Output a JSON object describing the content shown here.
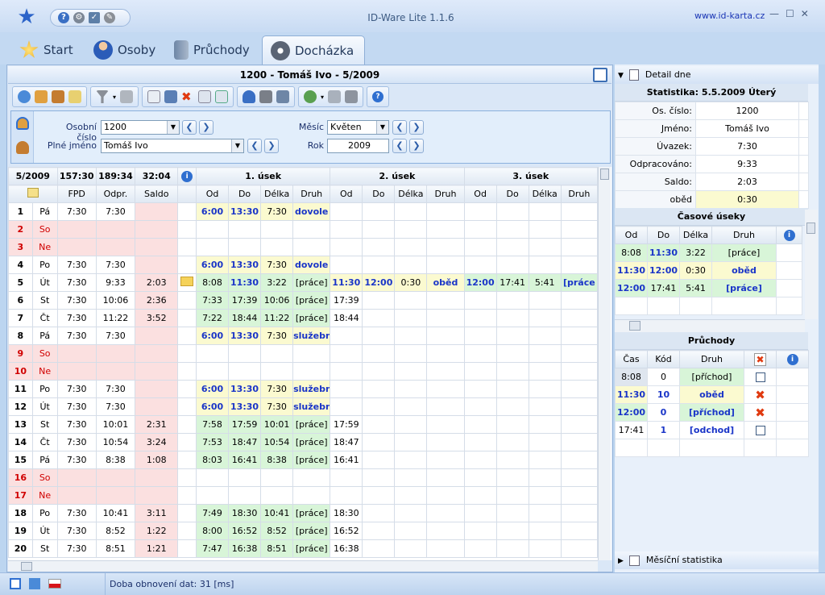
{
  "app": {
    "title": "ID-Ware Lite 1.1.6",
    "website": "www.id-karta.cz",
    "win_min": "—",
    "win_max": "☐",
    "win_close": "✕"
  },
  "tabs": [
    {
      "label": "Start"
    },
    {
      "label": "Osoby"
    },
    {
      "label": "Průchody"
    },
    {
      "label": "Docházka"
    }
  ],
  "main": {
    "title": "1200 - Tomáš Ivo - 5/2009"
  },
  "filter": {
    "personal_label": "Osobní číslo",
    "personal_value": "1200",
    "fullname_label": "Plné jméno",
    "fullname_value": "Tomáš Ivo",
    "month_label": "Měsíc",
    "month_value": "Květen",
    "year_label": "Rok",
    "year_value": "2009"
  },
  "grid": {
    "summary": [
      "5/2009",
      "157:30",
      "189:34",
      "32:04"
    ],
    "sections": [
      "1. úsek",
      "2. úsek",
      "3. úsek"
    ],
    "col_headers": [
      "FPD",
      "Odpr.",
      "Saldo"
    ],
    "seg_headers": [
      "Od",
      "Do",
      "Délka",
      "Druh"
    ],
    "rows": [
      {
        "n": "1",
        "d": "Pá",
        "fpd": "7:30",
        "odpr": "7:30",
        "saldo": "",
        "note": false,
        "s1": [
          "6:00",
          "13:30",
          "7:30",
          "dovole"
        ],
        "s1t": "y",
        "s2": [
          "",
          "",
          "",
          ""
        ],
        "s3": [
          "",
          "",
          "",
          ""
        ],
        "we": false
      },
      {
        "n": "2",
        "d": "So",
        "fpd": "",
        "odpr": "",
        "saldo": "",
        "note": false,
        "s1": [
          "",
          "",
          "",
          ""
        ],
        "s1t": "",
        "s2": [
          "",
          "",
          "",
          ""
        ],
        "s3": [
          "",
          "",
          "",
          ""
        ],
        "we": true
      },
      {
        "n": "3",
        "d": "Ne",
        "fpd": "",
        "odpr": "",
        "saldo": "",
        "note": false,
        "s1": [
          "",
          "",
          "",
          ""
        ],
        "s1t": "",
        "s2": [
          "",
          "",
          "",
          ""
        ],
        "s3": [
          "",
          "",
          "",
          ""
        ],
        "we": true
      },
      {
        "n": "4",
        "d": "Po",
        "fpd": "7:30",
        "odpr": "7:30",
        "saldo": "",
        "note": false,
        "s1": [
          "6:00",
          "13:30",
          "7:30",
          "dovole"
        ],
        "s1t": "y",
        "s2": [
          "",
          "",
          "",
          ""
        ],
        "s3": [
          "",
          "",
          "",
          ""
        ],
        "we": false
      },
      {
        "n": "5",
        "d": "Út",
        "fpd": "7:30",
        "odpr": "9:33",
        "saldo": "2:03",
        "note": true,
        "s1": [
          "8:08",
          "11:30",
          "3:22",
          "[práce]"
        ],
        "s1t": "g",
        "s2": [
          "11:30",
          "12:00",
          "0:30",
          "oběd"
        ],
        "s3": [
          "12:00",
          "17:41",
          "5:41",
          "[práce"
        ],
        "we": false
      },
      {
        "n": "6",
        "d": "St",
        "fpd": "7:30",
        "odpr": "10:06",
        "saldo": "2:36",
        "note": false,
        "s1": [
          "7:33",
          "17:39",
          "10:06",
          "[práce]"
        ],
        "s1t": "g",
        "s2": [
          "17:39",
          "",
          "",
          ""
        ],
        "s3": [
          "",
          "",
          "",
          ""
        ],
        "we": false
      },
      {
        "n": "7",
        "d": "Čt",
        "fpd": "7:30",
        "odpr": "11:22",
        "saldo": "3:52",
        "note": false,
        "s1": [
          "7:22",
          "18:44",
          "11:22",
          "[práce]"
        ],
        "s1t": "g",
        "s2": [
          "18:44",
          "",
          "",
          ""
        ],
        "s3": [
          "",
          "",
          "",
          ""
        ],
        "we": false
      },
      {
        "n": "8",
        "d": "Pá",
        "fpd": "7:30",
        "odpr": "7:30",
        "saldo": "",
        "note": false,
        "s1": [
          "6:00",
          "13:30",
          "7:30",
          "služebn"
        ],
        "s1t": "y",
        "s2": [
          "",
          "",
          "",
          ""
        ],
        "s3": [
          "",
          "",
          "",
          ""
        ],
        "we": false
      },
      {
        "n": "9",
        "d": "So",
        "fpd": "",
        "odpr": "",
        "saldo": "",
        "note": false,
        "s1": [
          "",
          "",
          "",
          ""
        ],
        "s1t": "",
        "s2": [
          "",
          "",
          "",
          ""
        ],
        "s3": [
          "",
          "",
          "",
          ""
        ],
        "we": true
      },
      {
        "n": "10",
        "d": "Ne",
        "fpd": "",
        "odpr": "",
        "saldo": "",
        "note": false,
        "s1": [
          "",
          "",
          "",
          ""
        ],
        "s1t": "",
        "s2": [
          "",
          "",
          "",
          ""
        ],
        "s3": [
          "",
          "",
          "",
          ""
        ],
        "we": true
      },
      {
        "n": "11",
        "d": "Po",
        "fpd": "7:30",
        "odpr": "7:30",
        "saldo": "",
        "note": false,
        "s1": [
          "6:00",
          "13:30",
          "7:30",
          "služebn"
        ],
        "s1t": "y",
        "s2": [
          "",
          "",
          "",
          ""
        ],
        "s3": [
          "",
          "",
          "",
          ""
        ],
        "we": false
      },
      {
        "n": "12",
        "d": "Út",
        "fpd": "7:30",
        "odpr": "7:30",
        "saldo": "",
        "note": false,
        "s1": [
          "6:00",
          "13:30",
          "7:30",
          "služebn"
        ],
        "s1t": "y",
        "s2": [
          "",
          "",
          "",
          ""
        ],
        "s3": [
          "",
          "",
          "",
          ""
        ],
        "we": false
      },
      {
        "n": "13",
        "d": "St",
        "fpd": "7:30",
        "odpr": "10:01",
        "saldo": "2:31",
        "note": false,
        "s1": [
          "7:58",
          "17:59",
          "10:01",
          "[práce]"
        ],
        "s1t": "g",
        "s2": [
          "17:59",
          "",
          "",
          ""
        ],
        "s3": [
          "",
          "",
          "",
          ""
        ],
        "we": false
      },
      {
        "n": "14",
        "d": "Čt",
        "fpd": "7:30",
        "odpr": "10:54",
        "saldo": "3:24",
        "note": false,
        "s1": [
          "7:53",
          "18:47",
          "10:54",
          "[práce]"
        ],
        "s1t": "g",
        "s2": [
          "18:47",
          "",
          "",
          ""
        ],
        "s3": [
          "",
          "",
          "",
          ""
        ],
        "we": false
      },
      {
        "n": "15",
        "d": "Pá",
        "fpd": "7:30",
        "odpr": "8:38",
        "saldo": "1:08",
        "note": false,
        "s1": [
          "8:03",
          "16:41",
          "8:38",
          "[práce]"
        ],
        "s1t": "g",
        "s2": [
          "16:41",
          "",
          "",
          ""
        ],
        "s3": [
          "",
          "",
          "",
          ""
        ],
        "we": false
      },
      {
        "n": "16",
        "d": "So",
        "fpd": "",
        "odpr": "",
        "saldo": "",
        "note": false,
        "s1": [
          "",
          "",
          "",
          ""
        ],
        "s1t": "",
        "s2": [
          "",
          "",
          "",
          ""
        ],
        "s3": [
          "",
          "",
          "",
          ""
        ],
        "we": true
      },
      {
        "n": "17",
        "d": "Ne",
        "fpd": "",
        "odpr": "",
        "saldo": "",
        "note": false,
        "s1": [
          "",
          "",
          "",
          ""
        ],
        "s1t": "",
        "s2": [
          "",
          "",
          "",
          ""
        ],
        "s3": [
          "",
          "",
          "",
          ""
        ],
        "we": true
      },
      {
        "n": "18",
        "d": "Po",
        "fpd": "7:30",
        "odpr": "10:41",
        "saldo": "3:11",
        "note": false,
        "s1": [
          "7:49",
          "18:30",
          "10:41",
          "[práce]"
        ],
        "s1t": "g",
        "s2": [
          "18:30",
          "",
          "",
          ""
        ],
        "s3": [
          "",
          "",
          "",
          ""
        ],
        "we": false
      },
      {
        "n": "19",
        "d": "Út",
        "fpd": "7:30",
        "odpr": "8:52",
        "saldo": "1:22",
        "note": false,
        "s1": [
          "8:00",
          "16:52",
          "8:52",
          "[práce]"
        ],
        "s1t": "g",
        "s2": [
          "16:52",
          "",
          "",
          ""
        ],
        "s3": [
          "",
          "",
          "",
          ""
        ],
        "we": false
      },
      {
        "n": "20",
        "d": "St",
        "fpd": "7:30",
        "odpr": "8:51",
        "saldo": "1:21",
        "note": false,
        "s1": [
          "7:47",
          "16:38",
          "8:51",
          "[práce]"
        ],
        "s1t": "g",
        "s2": [
          "16:38",
          "",
          "",
          ""
        ],
        "s3": [
          "",
          "",
          "",
          ""
        ],
        "we": false
      }
    ]
  },
  "right": {
    "detail_label": "Detail dne",
    "stats_title": "Statistika: 5.5.2009 Úterý",
    "stats": [
      {
        "k": "Os. číslo:",
        "v": "1200"
      },
      {
        "k": "Jméno:",
        "v": "Tomáš Ivo"
      },
      {
        "k": "Úvazek:",
        "v": "7:30"
      },
      {
        "k": "Odpracováno:",
        "v": "9:33"
      },
      {
        "k": "Saldo:",
        "v": "2:03"
      },
      {
        "k": "oběd",
        "v": "0:30"
      }
    ],
    "segments_title": "Časové úseky",
    "segments_headers": [
      "Od",
      "Do",
      "Délka",
      "Druh"
    ],
    "segments": [
      {
        "od": "8:08",
        "do": "11:30",
        "delka": "3:22",
        "druh": "[práce]",
        "t": "g",
        "hl": false
      },
      {
        "od": "11:30",
        "do": "12:00",
        "delka": "0:30",
        "druh": "oběd",
        "t": "y",
        "hl": true
      },
      {
        "od": "12:00",
        "do": "17:41",
        "delka": "5:41",
        "druh": "[práce]",
        "t": "g",
        "hl": true
      }
    ],
    "passes_title": "Průchody",
    "passes_headers": [
      "Čas",
      "Kód",
      "Druh"
    ],
    "passes": [
      {
        "cas": "8:08",
        "kod": "0",
        "druh": "[příchod]",
        "mark": "check",
        "bold": false
      },
      {
        "cas": "11:30",
        "kod": "10",
        "druh": "oběd",
        "mark": "x",
        "bold": true
      },
      {
        "cas": "12:00",
        "kod": "0",
        "druh": "[příchod]",
        "mark": "x",
        "bold": true
      },
      {
        "cas": "17:41",
        "kod": "1",
        "druh": "[odchod]",
        "mark": "check",
        "bold": false
      }
    ],
    "monthly_label": "Měsíční statistika"
  },
  "status": {
    "text": "Doba obnovení dat:  31 [ms]"
  },
  "colors": {
    "accent": "#2f6fd0",
    "weekend": "#d00000",
    "work": "#d8f5d8",
    "leave": "#fbfad0"
  }
}
